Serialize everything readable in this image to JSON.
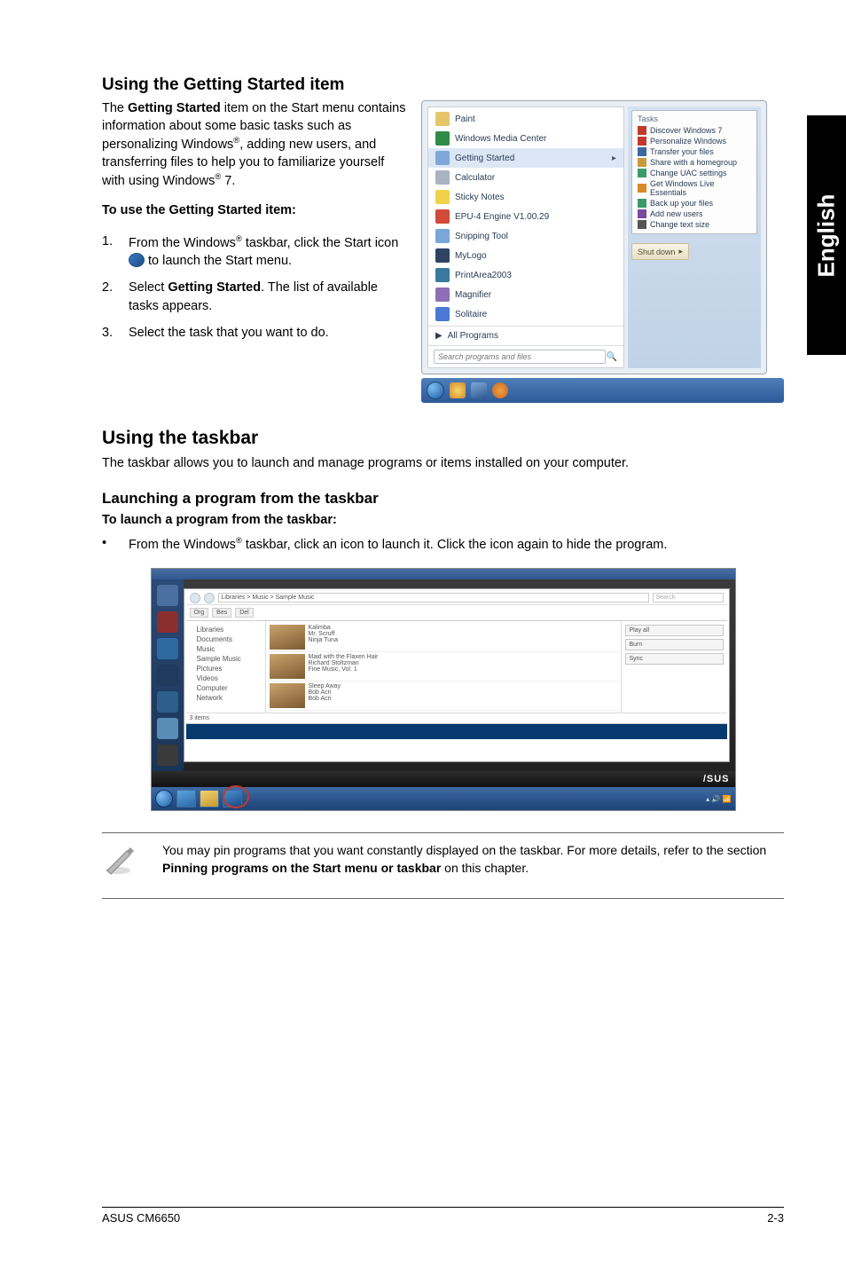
{
  "sideTab": "English",
  "section1": {
    "title": "Using the Getting Started item",
    "para": "The <b>Getting Started</b> item on the Start menu contains information about some basic tasks such as personalizing Windows<sup>®</sup>, adding new users, and transferring files to help you to familiarize yourself with using Windows<sup>®</sup> 7.",
    "subhead": "To use the Getting Started item:",
    "steps": [
      "From the Windows<sup>®</sup> taskbar, click the Start icon {ICON} to launch the Start menu.",
      "Select <b>Getting Started</b>. The list of available tasks appears.",
      "Select the task that you want to do."
    ]
  },
  "startMenu": {
    "leftItems": [
      {
        "label": "Paint",
        "color": "#e6c56b"
      },
      {
        "label": "Windows Media Center",
        "color": "#2f8b46"
      },
      {
        "label": "Getting Started",
        "color": "#7ea8d8",
        "highlight": true,
        "arrow": true
      },
      {
        "label": "Calculator",
        "color": "#a9b4c2"
      },
      {
        "label": "Sticky Notes",
        "color": "#f0d24a"
      },
      {
        "label": "EPU-4 Engine V1.00.29",
        "color": "#d24a3a"
      },
      {
        "label": "Snipping Tool",
        "color": "#7aa6d8"
      },
      {
        "label": "MyLogo",
        "color": "#2f4464"
      },
      {
        "label": "PrintArea2003",
        "color": "#3a7a9e"
      },
      {
        "label": "Magnifier",
        "color": "#8e6fb5"
      },
      {
        "label": "Solitaire",
        "color": "#4a7ad6"
      }
    ],
    "allPrograms": "All Programs",
    "searchPlaceholder": "Search programs and files",
    "tasksTitle": "Tasks",
    "tasks": [
      {
        "label": "Discover Windows 7",
        "color": "#c0392b"
      },
      {
        "label": "Personalize Windows",
        "color": "#c0392b"
      },
      {
        "label": "Transfer your files",
        "color": "#3a6aa0"
      },
      {
        "label": "Share with a homegroup",
        "color": "#c79a3a"
      },
      {
        "label": "Change UAC settings",
        "color": "#3a9a6a"
      },
      {
        "label": "Get Windows Live Essentials",
        "color": "#d68a2a"
      },
      {
        "label": "Back up your files",
        "color": "#3a9a6a"
      },
      {
        "label": "Add new users",
        "color": "#7a4aa0"
      },
      {
        "label": "Change text size",
        "color": "#555"
      }
    ],
    "shutdown": "Shut down"
  },
  "section2": {
    "title": "Using the taskbar",
    "para": "The taskbar allows you to launch and manage programs or items installed on your computer."
  },
  "section3": {
    "title": "Launching a program from the taskbar",
    "subhead": "To launch a program from the taskbar:",
    "bullet": "From the Windows<sup>®</sup> taskbar, click an icon to launch it. Click the icon again to hide the program."
  },
  "explorer": {
    "tabs": [
      "Org",
      "Bes",
      "Del"
    ],
    "address": "Libraries > Music > Sample Music",
    "tree": [
      "Libraries",
      "Documents",
      "Music",
      "Sample Music",
      "Pictures",
      "Videos",
      "Computer",
      "Network"
    ],
    "items": [
      {
        "title": "Kalimba",
        "artist": "Mr. Scruff",
        "album": "Ninja Tuna"
      },
      {
        "title": "Maid with the Flaxen Hair",
        "artist": "Richard Stoltzman",
        "album": "Fine Music, Vol. 1"
      },
      {
        "title": "Sleep Away",
        "artist": "Bob Acri",
        "album": "Bob Acri"
      }
    ],
    "right": [
      "Play all",
      "Burn",
      "Sync"
    ],
    "status": "3 items",
    "brand": "/SUS"
  },
  "note": "You may pin programs that you want constantly displayed on the taskbar. For more details, refer to the section <b>Pinning programs on the Start menu or taskbar</b> on this chapter.",
  "footer": {
    "left": "ASUS CM6650",
    "right": "2-3"
  }
}
